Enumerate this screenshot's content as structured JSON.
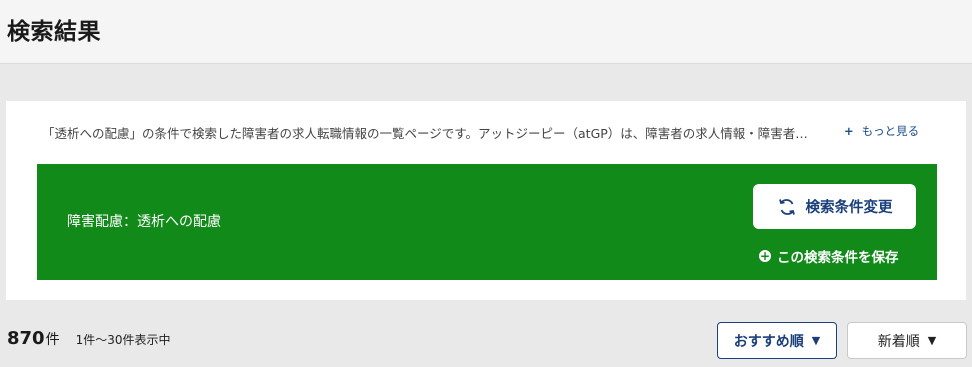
{
  "header": {
    "title": "検索結果"
  },
  "search": {
    "description": "「透析への配慮」の条件で検索した障害者の求人転職情報の一覧ページです。アットジーピー（atGP）は、障害者の求人情報・障害者…",
    "more_label": "もっと見る",
    "more_icon": "plus-icon",
    "condition_text": "障害配慮：透析への配慮",
    "change_button_label": "検索条件変更",
    "change_button_icon": "refresh-icon",
    "save_label": "この検索条件を保存",
    "save_icon": "plus-circle-icon",
    "panel_color": "#118a1a",
    "accent_color": "#1a3f7a"
  },
  "results": {
    "count": "870",
    "count_unit": "件",
    "range": "1件～30件表示中"
  },
  "sort": {
    "recommend_label": "おすすめ順",
    "new_label": "新着順",
    "dropdown_icon": "triangle-down-icon"
  }
}
